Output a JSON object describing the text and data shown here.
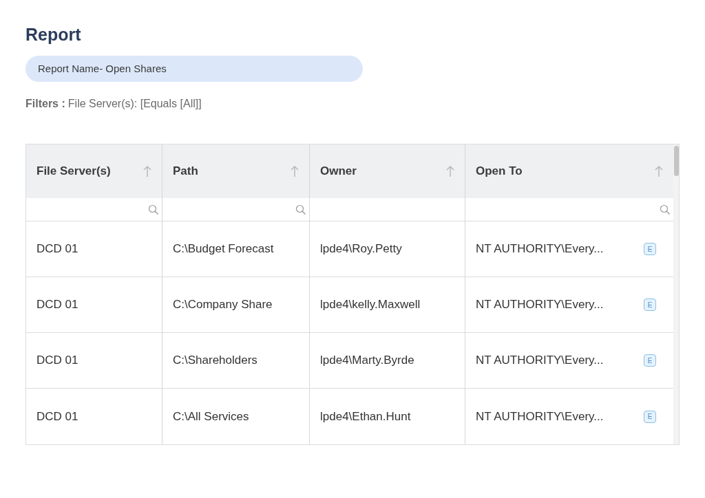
{
  "title": "Report",
  "report_name": "Report Name- Open Shares",
  "filters": {
    "label": "Filters :",
    "value": "File Server(s): [Equals [All]]"
  },
  "table": {
    "columns": [
      {
        "label": "File Server(s)",
        "filter": true
      },
      {
        "label": "Path",
        "filter": true
      },
      {
        "label": "Owner",
        "filter": false
      },
      {
        "label": "Open To",
        "filter": true
      }
    ],
    "rows": [
      {
        "cells": [
          "DCD 01",
          "C:\\Budget Forecast",
          "lpde4\\Roy.Petty",
          "NT AUTHORITY\\Every..."
        ],
        "badge": "E"
      },
      {
        "cells": [
          "DCD 01",
          "C:\\Company Share",
          "lpde4\\kelly.Maxwell",
          "NT AUTHORITY\\Every..."
        ],
        "badge": "E"
      },
      {
        "cells": [
          "DCD 01",
          "C:\\Shareholders",
          "lpde4\\Marty.Byrde",
          "NT AUTHORITY\\Every..."
        ],
        "badge": "E"
      },
      {
        "cells": [
          "DCD 01",
          "C:\\All Services",
          "lpde4\\Ethan.Hunt",
          "NT AUTHORITY\\Every..."
        ],
        "badge": "E"
      }
    ]
  }
}
